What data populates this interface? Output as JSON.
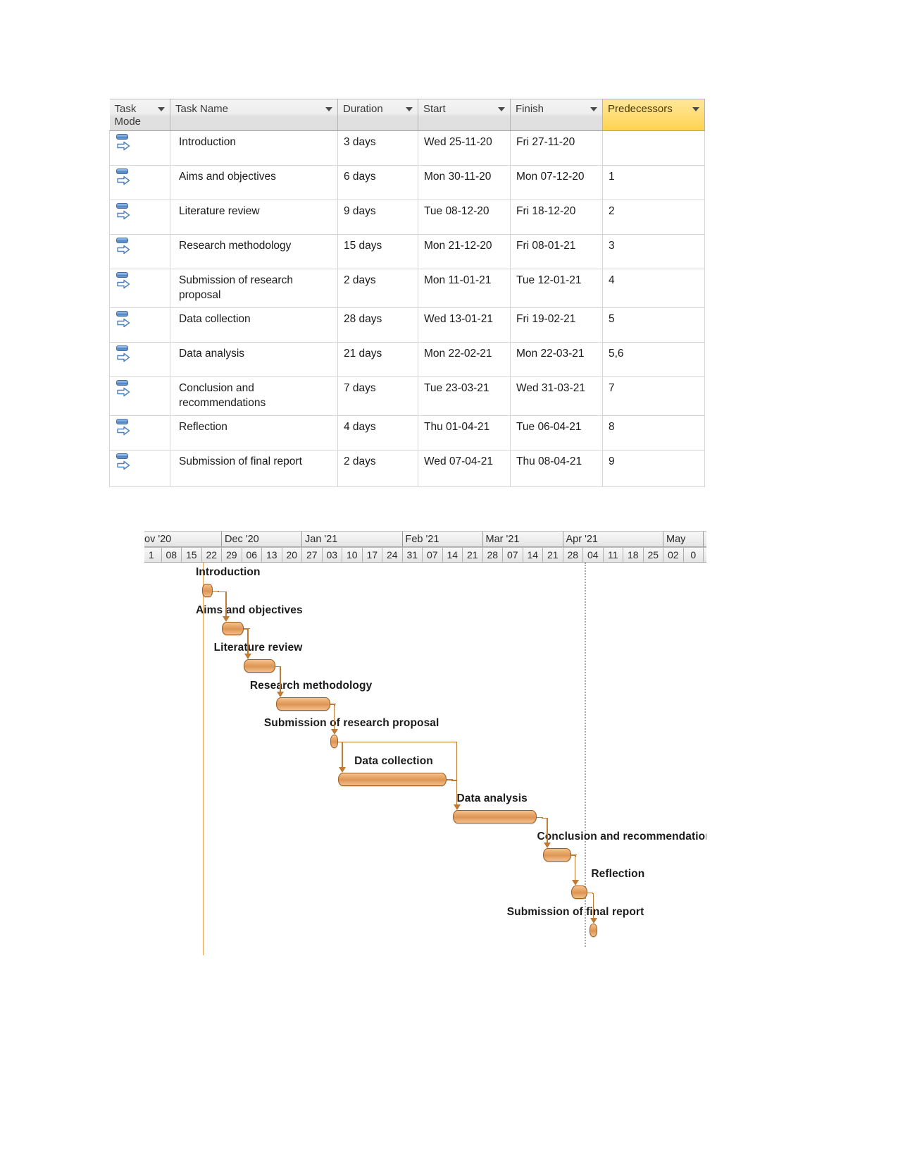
{
  "table": {
    "columns": [
      {
        "label": "Task Mode",
        "key": "mode",
        "has_filter": true,
        "highlight": false
      },
      {
        "label": "Task Name",
        "key": "name",
        "has_filter": true,
        "highlight": false
      },
      {
        "label": "Duration",
        "key": "duration",
        "has_filter": true,
        "highlight": false
      },
      {
        "label": "Start",
        "key": "start",
        "has_filter": true,
        "highlight": false
      },
      {
        "label": "Finish",
        "key": "finish",
        "has_filter": true,
        "highlight": false
      },
      {
        "label": "Predecessors",
        "key": "predecessors",
        "has_filter": true,
        "highlight": true
      }
    ],
    "header_highlight_color": "#FFD34D",
    "task_mode_icon": "auto-scheduled-icon",
    "rows": [
      {
        "id": 1,
        "name": "Introduction",
        "duration": "3 days",
        "start": "Wed 25-11-20",
        "finish": "Fri 27-11-20",
        "predecessors": ""
      },
      {
        "id": 2,
        "name": "Aims and objectives",
        "duration": "6 days",
        "start": "Mon 30-11-20",
        "finish": "Mon 07-12-20",
        "predecessors": "1"
      },
      {
        "id": 3,
        "name": "Literature review",
        "duration": "9 days",
        "start": "Tue 08-12-20",
        "finish": "Fri 18-12-20",
        "predecessors": "2"
      },
      {
        "id": 4,
        "name": "Research methodology",
        "duration": "15 days",
        "start": "Mon 21-12-20",
        "finish": "Fri 08-01-21",
        "predecessors": "3"
      },
      {
        "id": 5,
        "name": "Submission of research proposal",
        "duration": "2 days",
        "start": "Mon 11-01-21",
        "finish": "Tue 12-01-21",
        "predecessors": "4"
      },
      {
        "id": 6,
        "name": "Data collection",
        "duration": "28 days",
        "start": "Wed 13-01-21",
        "finish": "Fri 19-02-21",
        "predecessors": "5"
      },
      {
        "id": 7,
        "name": "Data analysis",
        "duration": "21 days",
        "start": "Mon 22-02-21",
        "finish": "Mon 22-03-21",
        "predecessors": "5,6"
      },
      {
        "id": 8,
        "name": "Conclusion and recommendations",
        "duration": "7 days",
        "start": "Tue 23-03-21",
        "finish": "Wed 31-03-21",
        "predecessors": "7"
      },
      {
        "id": 9,
        "name": "Reflection",
        "duration": "4 days",
        "start": "Thu 01-04-21",
        "finish": "Tue 06-04-21",
        "predecessors": "8"
      },
      {
        "id": 10,
        "name": "Submission of final report",
        "duration": "2 days",
        "start": "Wed 07-04-21",
        "finish": "Thu 08-04-21",
        "predecessors": "9"
      }
    ]
  },
  "chart_data": {
    "type": "bar",
    "chart_style": "gantt",
    "title": "",
    "xlabel": "",
    "ylabel": "",
    "bar_color": "#DD9553",
    "bar_border_color": "#9C5E1E",
    "link_color": "#C07A33",
    "timescale": {
      "months": [
        {
          "label": "ov '20",
          "weeks": 4,
          "clipped": true
        },
        {
          "label": "Dec '20",
          "weeks": 4,
          "clipped": false
        },
        {
          "label": "Jan '21",
          "weeks": 5,
          "clipped": false
        },
        {
          "label": "Feb '21",
          "weeks": 4,
          "clipped": false
        },
        {
          "label": "Mar '21",
          "weeks": 4,
          "clipped": false
        },
        {
          "label": "Apr '21",
          "weeks": 5,
          "clipped": false
        },
        {
          "label": "May",
          "weeks": 2,
          "clipped": true
        }
      ],
      "weeks": [
        "1",
        "08",
        "15",
        "22",
        "29",
        "06",
        "13",
        "20",
        "27",
        "03",
        "10",
        "17",
        "24",
        "31",
        "07",
        "14",
        "21",
        "28",
        "07",
        "14",
        "21",
        "28",
        "04",
        "11",
        "18",
        "25",
        "02",
        "0"
      ]
    },
    "project_start_line_week_index": 3,
    "status_line_week_index": 22,
    "tasks": [
      {
        "name": "Introduction",
        "start_week": 3.0,
        "duration_weeks": 0.55,
        "label_offset_weeks": -0.3
      },
      {
        "name": "Aims and objectives",
        "start_week": 4.0,
        "duration_weeks": 1.1,
        "label_offset_weeks": -1.3
      },
      {
        "name": "Literature review",
        "start_week": 5.1,
        "duration_weeks": 1.55,
        "label_offset_weeks": -1.5
      },
      {
        "name": "Research methodology",
        "start_week": 6.7,
        "duration_weeks": 2.7,
        "label_offset_weeks": -1.3
      },
      {
        "name": "Submission of research proposal",
        "start_week": 9.4,
        "duration_weeks": 0.4,
        "label_offset_weeks": -3.3
      },
      {
        "name": "Data collection",
        "start_week": 9.8,
        "duration_weeks": 5.4,
        "label_offset_weeks": 0.8
      },
      {
        "name": "Data analysis",
        "start_week": 15.5,
        "duration_weeks": 4.2,
        "label_offset_weeks": 0.2
      },
      {
        "name": "Conclusion and recommendations",
        "start_week": 20.0,
        "duration_weeks": 1.4,
        "label_offset_weeks": -0.3
      },
      {
        "name": "Reflection",
        "start_week": 21.4,
        "duration_weeks": 0.8,
        "label_offset_weeks": 1.0
      },
      {
        "name": "Submission of final report",
        "start_week": 22.3,
        "duration_weeks": 0.4,
        "label_offset_weeks": -4.1
      }
    ]
  }
}
